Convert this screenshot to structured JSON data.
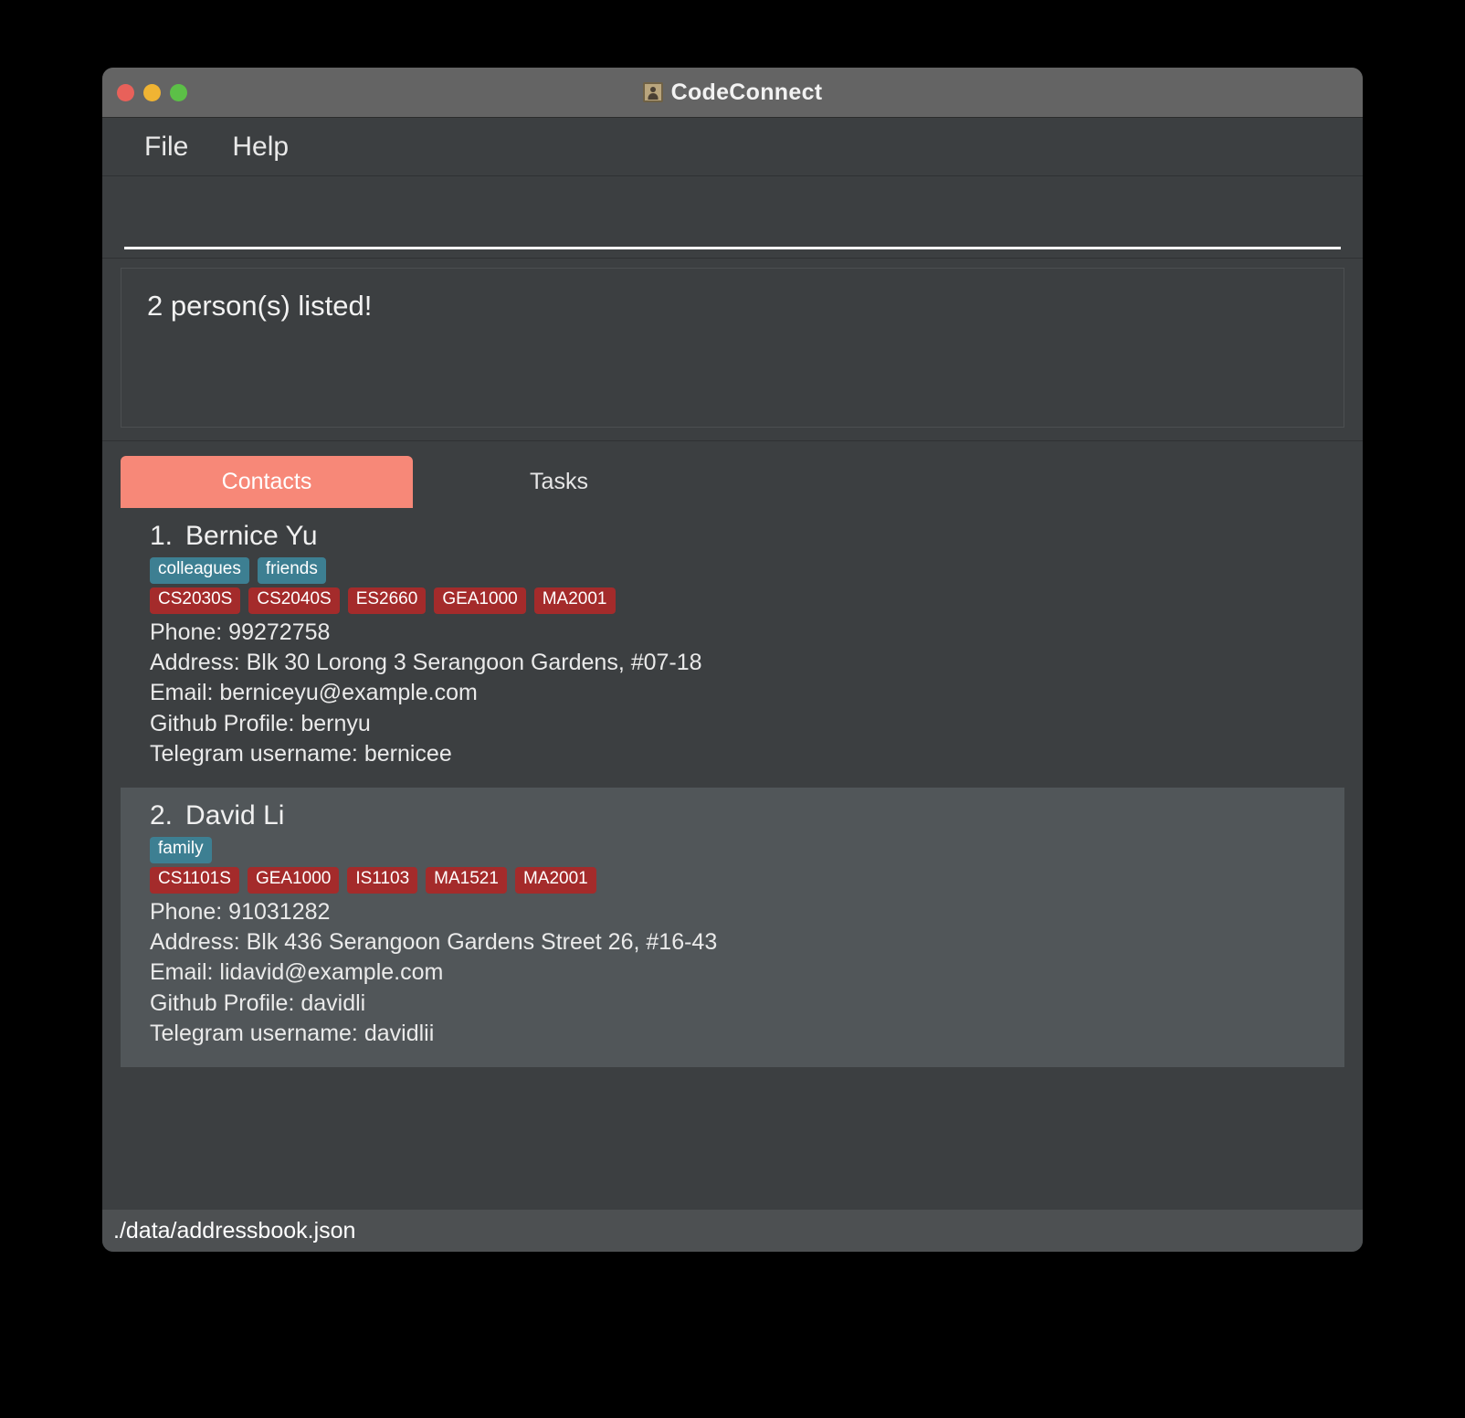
{
  "window": {
    "title": "CodeConnect",
    "icon": "address-book-icon",
    "traffic_lights": {
      "close_color": "#e8615a",
      "minimize_color": "#f0b433",
      "maximize_color": "#5cc047"
    }
  },
  "menu": {
    "items": [
      {
        "label": "File"
      },
      {
        "label": "Help"
      }
    ]
  },
  "command": {
    "value": "",
    "placeholder": ""
  },
  "result": {
    "text": "2 person(s) listed!"
  },
  "tabs": [
    {
      "label": "Contacts",
      "active": true
    },
    {
      "label": "Tasks",
      "active": false
    }
  ],
  "colors": {
    "accent": "#f78878",
    "tag_chip": "#3d7f92",
    "course_chip": "#a42b2b",
    "card_bg": "#3c3f41",
    "card_selected_bg": "#515659",
    "window_bg": "#3c3f41",
    "title_bar_bg": "#646464",
    "status_bar_bg": "#4d5052"
  },
  "persons": [
    {
      "index": "1.",
      "name": "Bernice Yu",
      "selected": false,
      "tags": [
        "colleagues",
        "friends"
      ],
      "courses": [
        "CS2030S",
        "CS2040S",
        "ES2660",
        "GEA1000",
        "MA2001"
      ],
      "details": [
        "Phone: 99272758",
        "Address: Blk 30 Lorong 3 Serangoon Gardens, #07-18",
        "Email: berniceyu@example.com",
        "Github Profile: bernyu",
        "Telegram username: bernicee"
      ]
    },
    {
      "index": "2.",
      "name": "David Li",
      "selected": true,
      "tags": [
        "family"
      ],
      "courses": [
        "CS1101S",
        "GEA1000",
        "IS1103",
        "MA1521",
        "MA2001"
      ],
      "details": [
        "Phone: 91031282",
        "Address: Blk 436 Serangoon Gardens Street 26, #16-43",
        "Email: lidavid@example.com",
        "Github Profile: davidli",
        "Telegram username: davidlii"
      ]
    }
  ],
  "status_bar": {
    "file_path": "./data/addressbook.json"
  }
}
